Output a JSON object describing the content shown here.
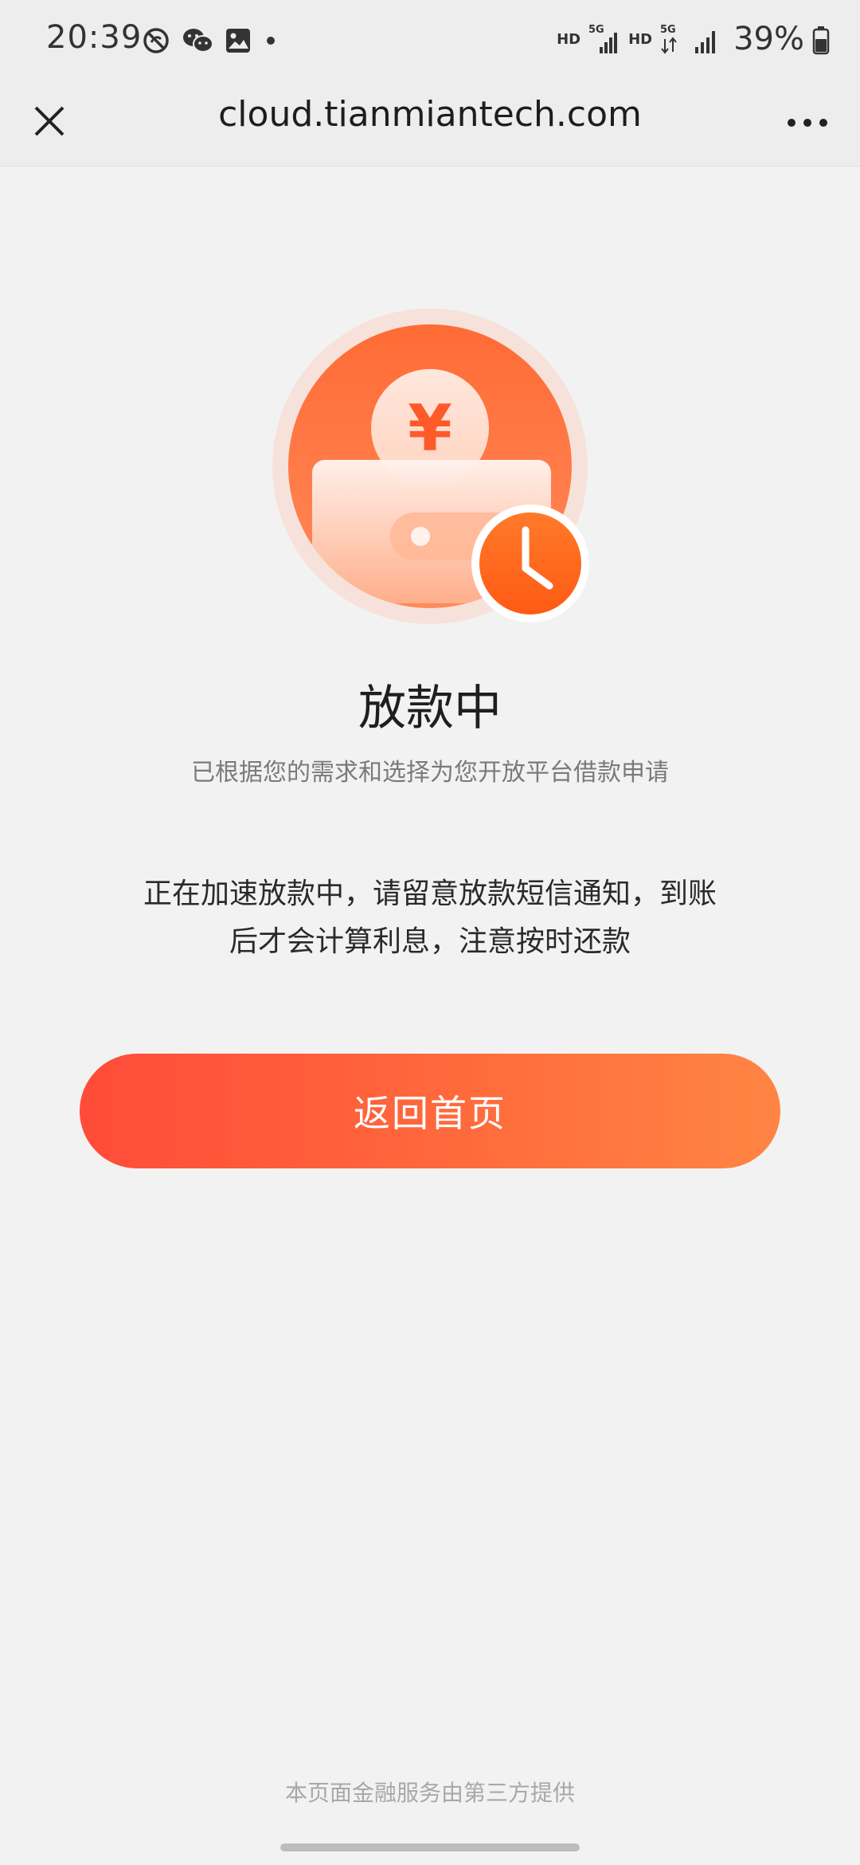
{
  "status_bar": {
    "time": "20:39",
    "network_1": "HD",
    "network_1_gen": "5G",
    "network_2": "HD",
    "network_2_gen": "5G",
    "battery_percent": "39%"
  },
  "nav": {
    "title": "cloud.tianmiantech.com"
  },
  "hero": {
    "currency_symbol": "¥",
    "icon": "loan-pending-illustration"
  },
  "content": {
    "title": "放款中",
    "subtitle": "已根据您的需求和选择为您开放平台借款申请",
    "message_line1": "正在加速放款中，请留意放款短信通知，到账",
    "message_line2": "后才会计算利息，注意按时还款",
    "button_label": "返回首页"
  },
  "footer": {
    "note": "本页面金融服务由第三方提供"
  },
  "colors": {
    "accent": "#ff6a3c",
    "button_start": "#ff4b39",
    "button_end": "#ff8544",
    "background": "#f2f2f2"
  }
}
